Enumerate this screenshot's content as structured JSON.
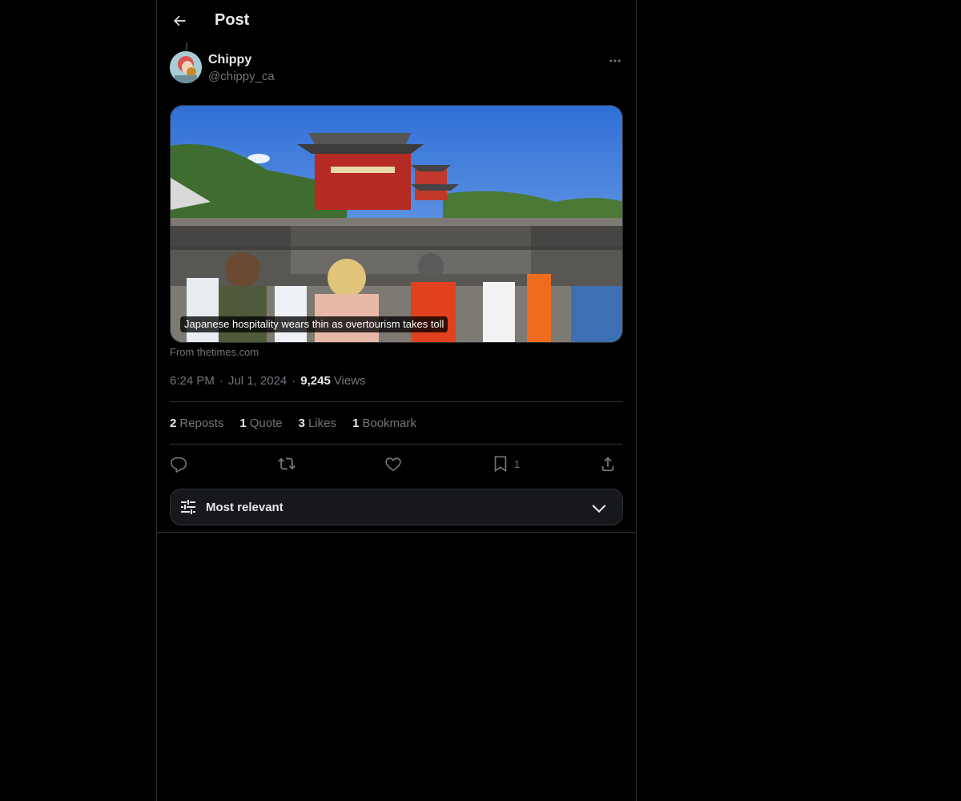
{
  "header": {
    "title": "Post",
    "back_icon": "arrow-left-icon"
  },
  "author": {
    "display_name": "Chippy",
    "handle": "@chippy_ca"
  },
  "card": {
    "caption": "Japanese hospitality wears thin as overtourism takes toll",
    "source": "From thetimes.com"
  },
  "meta": {
    "time": "6:24 PM",
    "date": "Jul 1, 2024",
    "views_count": "9,245",
    "views_label": "Views"
  },
  "stats": {
    "reposts_count": "2",
    "reposts_label": "Reposts",
    "quotes_count": "1",
    "quotes_label": "Quote",
    "likes_count": "3",
    "likes_label": "Likes",
    "bookmarks_count": "1",
    "bookmarks_label": "Bookmark"
  },
  "actions": {
    "bookmark_count": "1"
  },
  "sort": {
    "label": "Most relevant"
  },
  "colors": {
    "background": "#000000",
    "text": "#e7e9ea",
    "muted": "#71767b",
    "border": "#2f3336"
  }
}
